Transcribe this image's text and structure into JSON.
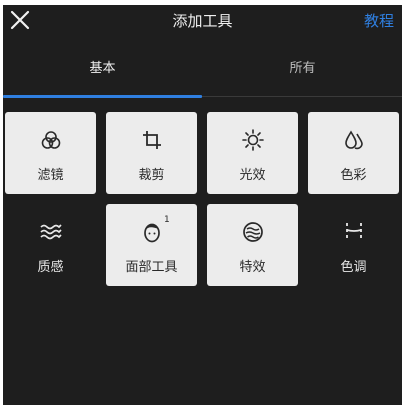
{
  "header": {
    "title": "添加工具",
    "tutorial_label": "教程",
    "close_icon": "close-icon"
  },
  "tabs": [
    {
      "label": "基本",
      "active": true
    },
    {
      "label": "所有",
      "active": false
    }
  ],
  "colors": {
    "accent": "#2f7fe0",
    "background": "#1e1e1e",
    "tile_light": "#ececec"
  },
  "tools": [
    {
      "label": "滤镜",
      "icon": "filter-icon"
    },
    {
      "label": "裁剪",
      "icon": "crop-icon"
    },
    {
      "label": "光效",
      "icon": "light-effect-icon"
    },
    {
      "label": "色彩",
      "icon": "color-drops-icon"
    },
    {
      "label": "质感",
      "icon": "texture-waves-icon"
    },
    {
      "label": "面部工具",
      "icon": "face-icon",
      "badge": "1"
    },
    {
      "label": "特效",
      "icon": "effects-icon"
    },
    {
      "label": "色调",
      "icon": "tone-curve-icon"
    }
  ]
}
